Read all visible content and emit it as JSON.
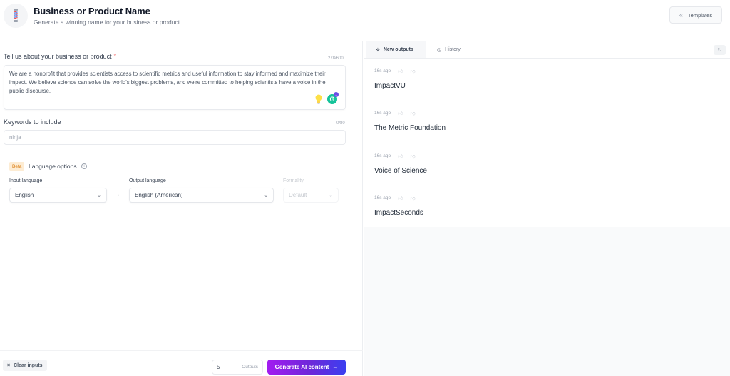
{
  "header": {
    "title": "Business or Product Name",
    "subtitle": "Generate a winning name for your business or product.",
    "logo_icon": "barber-pole-icon",
    "templates_label": "Templates",
    "templates_icon": "double-chevron-left-icon"
  },
  "form": {
    "description": {
      "label": "Tell us about your business or product",
      "required_mark": "*",
      "counter": "278/600",
      "value": "We are a nonprofit that provides scientists access to scientific metrics and useful information to stay informed and maximize their impact. We believe science can solve the world's biggest problems, and we're committed to helping scientists have a voice in the public discourse."
    },
    "keywords": {
      "label": "Keywords to include",
      "counter": "0/80",
      "placeholder": "ninja",
      "value": ""
    },
    "language": {
      "badge": "Beta",
      "title": "Language options",
      "input_label": "Input language",
      "input_value": "English",
      "output_label": "Output language",
      "output_value": "English (American)",
      "formality_label": "Formality",
      "formality_value": "Default",
      "arrow": "→"
    }
  },
  "footer": {
    "clear_label": "Clear inputs",
    "clear_icon": "×",
    "outputs_count": "5",
    "outputs_label": "Outputs",
    "generate_label": "Generate AI content",
    "generate_icon": "→"
  },
  "panel": {
    "tabs": [
      {
        "label": "New outputs",
        "icon": "✧",
        "active": true
      },
      {
        "label": "History",
        "icon": "◷",
        "active": false
      }
    ],
    "refresh_icon": "↻",
    "results": [
      {
        "time": "16s ago",
        "name": "ImpactVU"
      },
      {
        "time": "16s ago",
        "name": "The Metric Foundation"
      },
      {
        "time": "16s ago",
        "name": "Voice of Science"
      },
      {
        "time": "16s ago",
        "name": "ImpactSeconds"
      }
    ]
  },
  "colors": {
    "accent_start": "#a21cf0",
    "accent_end": "#3b3ff0",
    "beta_bg": "#fdecd3",
    "beta_text": "#d97706"
  }
}
